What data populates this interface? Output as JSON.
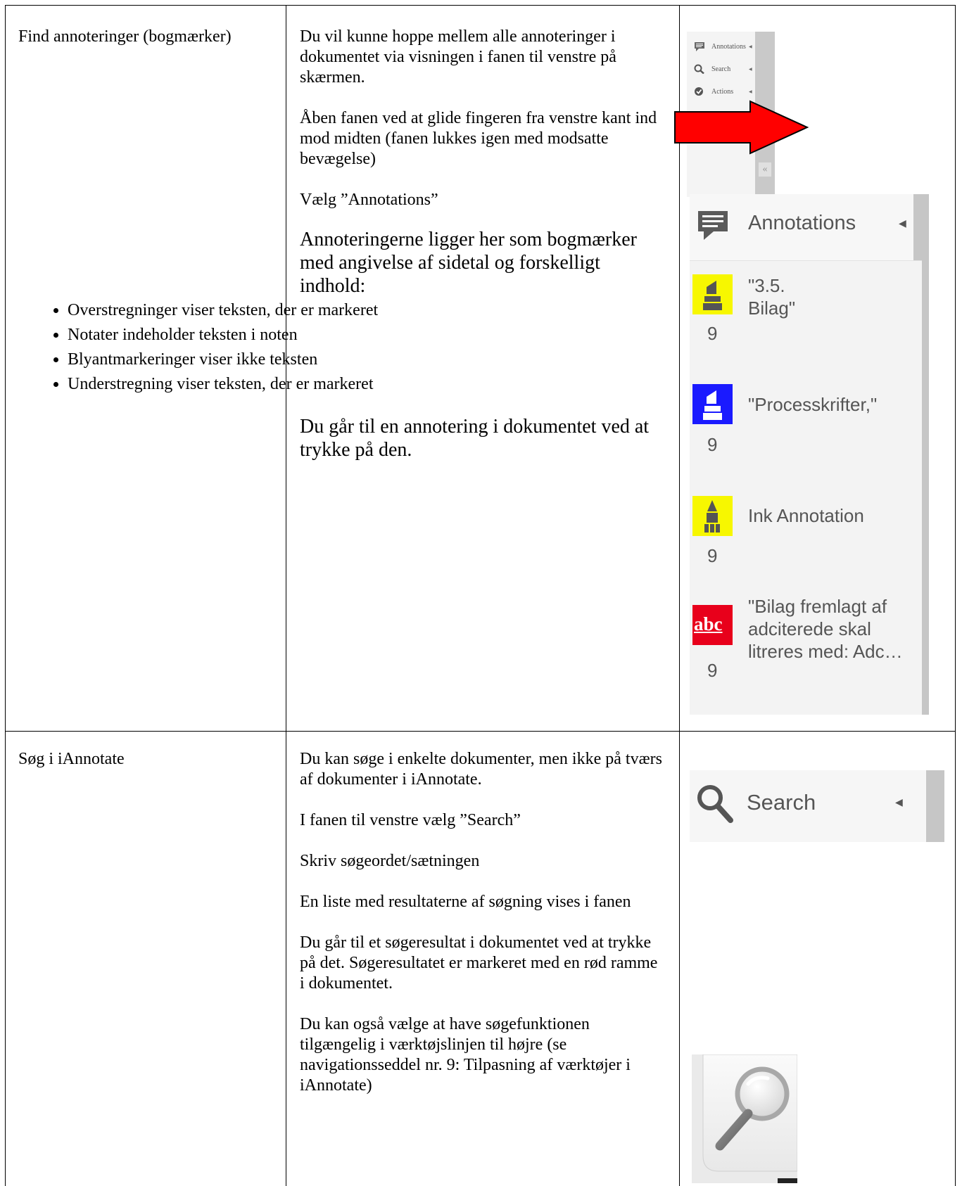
{
  "rows": [
    {
      "feature": "Find annoteringer (bogmærker)",
      "paras": [
        "Du vil kunne hoppe mellem alle annoteringer i dokumentet via visningen i fanen til venstre på skærmen.",
        "Åben fanen ved at glide fingeren fra venstre kant ind mod midten (fanen lukkes igen med modsatte bevægelse)",
        "Vælg ”Annotations”"
      ],
      "intro": "Annoteringerne ligger her som bogmærker med angivelse af sidetal og forskelligt indhold:",
      "bullets": [
        "Overstregninger viser teksten, der er markeret",
        "Notater indeholder teksten i noten",
        "Blyantmarkeringer viser ikke teksten",
        "Understregning viser teksten, der er markeret"
      ],
      "outro": "Du går til en annotering i dokumentet ved at trykke på den."
    },
    {
      "feature": "Søg i iAnnotate",
      "paras": [
        "Du kan søge i enkelte dokumenter, men ikke på tværs af dokumenter i iAnnotate.",
        "I fanen til venstre vælg ”Search”",
        "Skriv søgeordet/sætningen",
        "En liste med resultaterne af søgning vises i fanen",
        "Du går til et søgeresultat i dokumentet ved at trykke på det. Søgeresultatet er markeret med en rød ramme i dokumentet.",
        "Du kan også vælge at have søgefunktionen tilgængelig i værktøjslinjen til højre (se navigationsseddel nr. 9: Tilpasning af værktøjer i iAnnotate)"
      ]
    }
  ],
  "small_sidebar": {
    "items": [
      {
        "label": "Annotations",
        "icon": "speech-bubble-icon"
      },
      {
        "label": "Search",
        "icon": "magnifier-icon"
      },
      {
        "label": "Actions",
        "icon": "check-circle-icon"
      }
    ]
  },
  "annotations_panel": {
    "title": "Annotations",
    "items": [
      {
        "text_lines": [
          "\"3.5.",
          "Bilag\""
        ],
        "page": "9",
        "icon": "yellow-highlighter-icon"
      },
      {
        "text_lines": [
          "\"Processkrifter,\""
        ],
        "page": "9",
        "icon": "blue-highlighter-icon"
      },
      {
        "text_lines": [
          "Ink Annotation"
        ],
        "page": "9",
        "icon": "yellow-pencil-icon"
      },
      {
        "text_lines": [
          "\"Bilag fremlagt af",
          "adciterede skal",
          "litreres med: Adc…"
        ],
        "page": "9",
        "icon": "abc-underline-icon",
        "icon_text": "abc"
      }
    ]
  },
  "search_panel": {
    "title": "Search"
  },
  "colors": {
    "arrow": "#ff0000",
    "highlight_yellow": "#f7f700",
    "highlight_blue": "#1a1aff",
    "underline_red": "#e8001b"
  }
}
